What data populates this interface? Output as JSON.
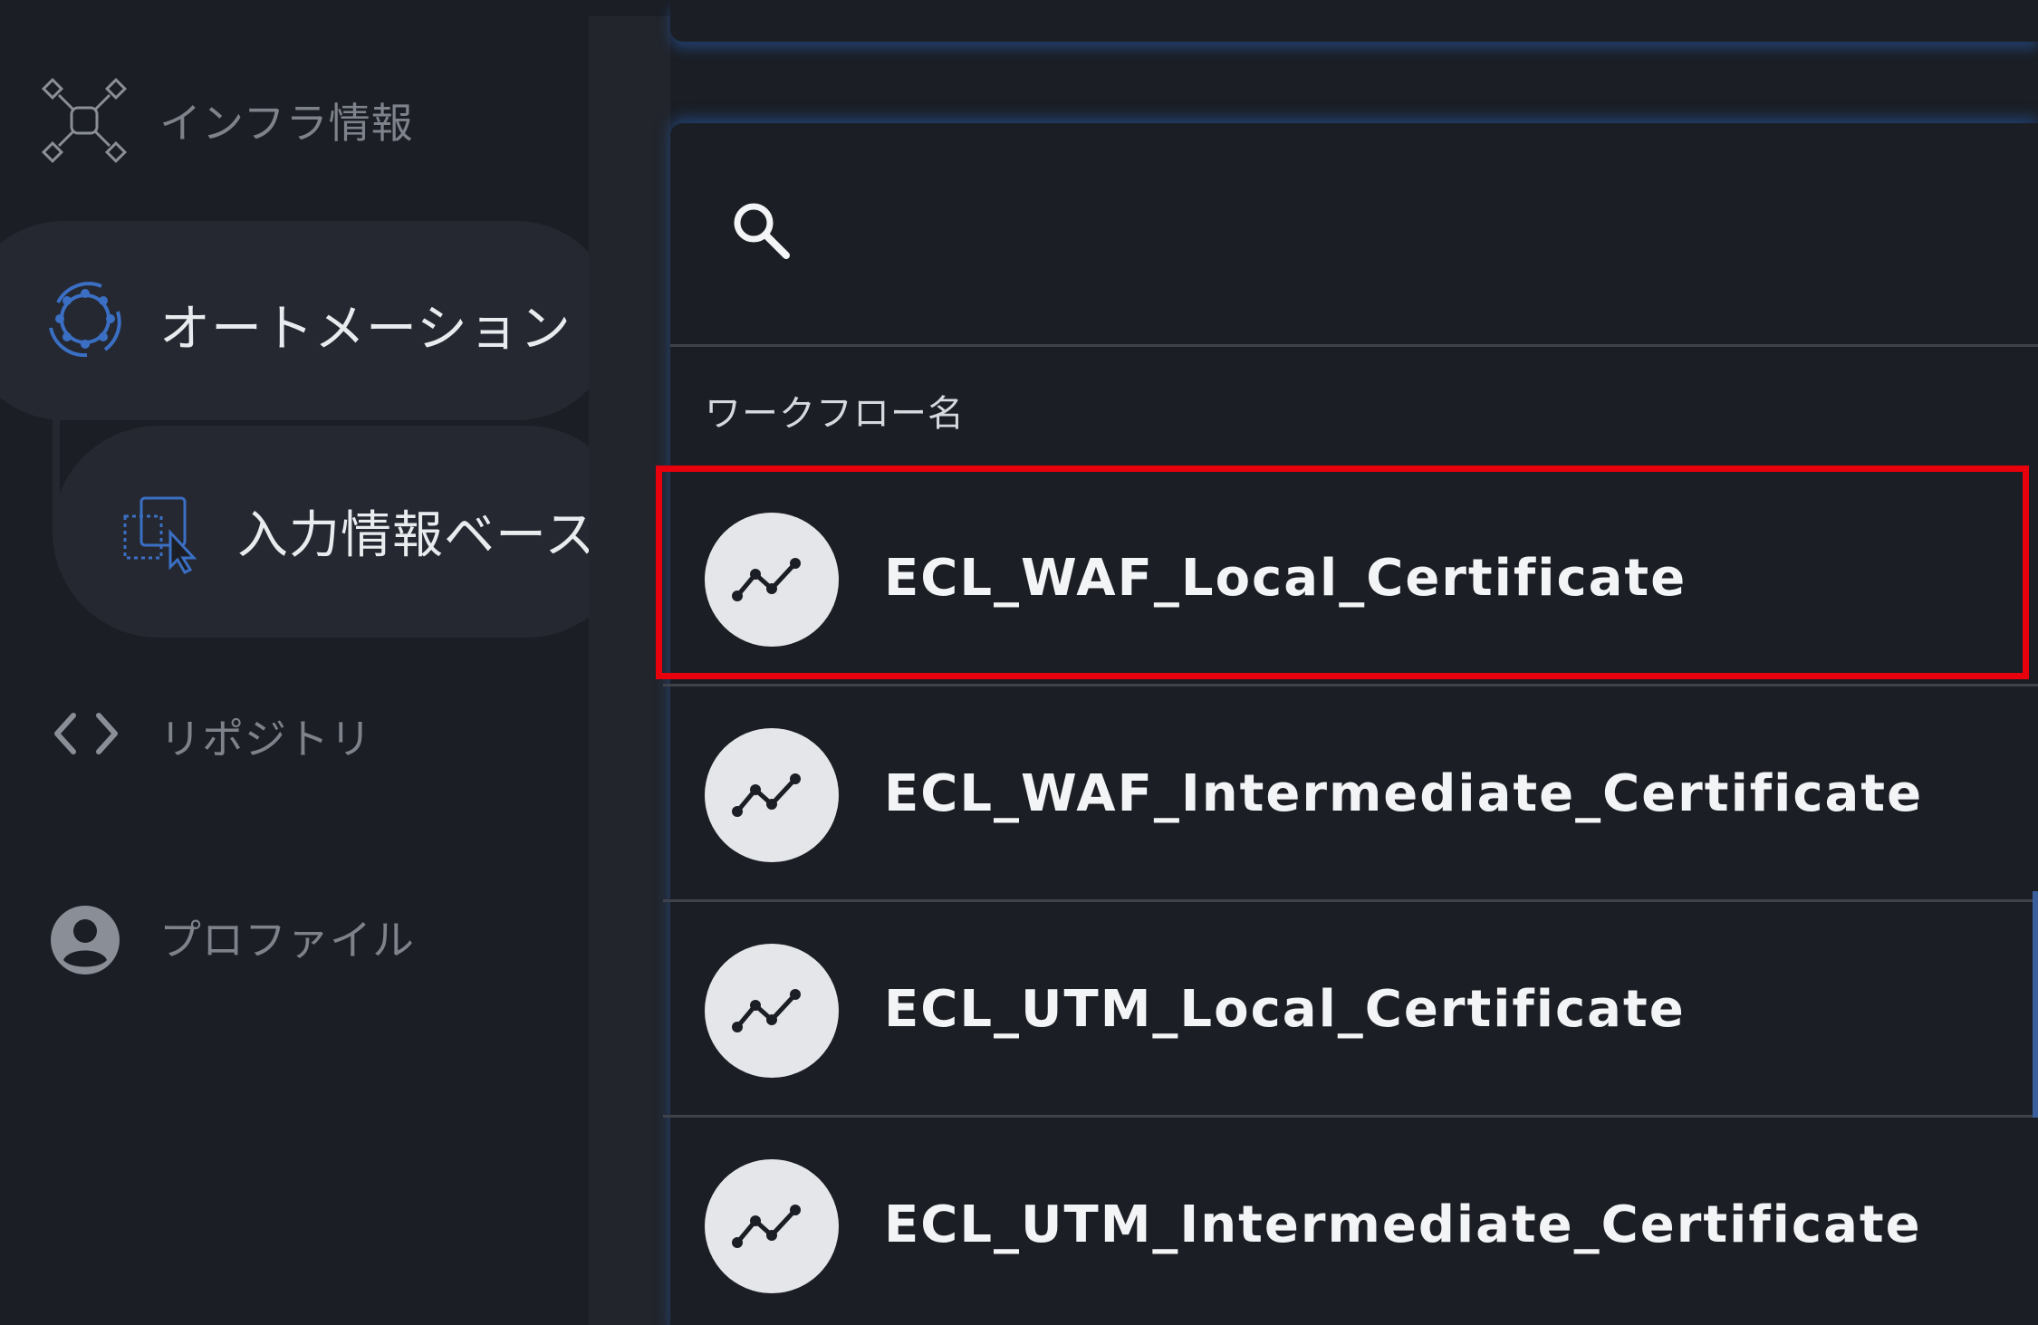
{
  "sidebar": {
    "items": [
      {
        "label": "インフラ情報",
        "icon": "network-nodes-icon",
        "active": false
      },
      {
        "label": "オートメーション",
        "icon": "automation-gear-icon",
        "active": true
      },
      {
        "label": "入力情報ベース",
        "icon": "input-cursor-icon",
        "active": true,
        "sub_item": true
      },
      {
        "label": "リポジトリ",
        "icon": "code-brackets-icon",
        "active": false
      },
      {
        "label": "プロファイル",
        "icon": "account-circle-icon",
        "active": false
      }
    ]
  },
  "search": {
    "placeholder": "",
    "value": ""
  },
  "table": {
    "column_header": "ワークフロー名",
    "rows": [
      {
        "name": "ECL_WAF_Local_Certificate",
        "highlighted": true
      },
      {
        "name": "ECL_WAF_Intermediate_Certificate",
        "highlighted": false
      },
      {
        "name": "ECL_UTM_Local_Certificate",
        "highlighted": false
      },
      {
        "name": "ECL_UTM_Intermediate_Certificate",
        "highlighted": false
      }
    ]
  },
  "colors": {
    "background": "#1b1e24",
    "active_pill": "#252830",
    "accent_blue": "#3a6fc4",
    "highlight_red": "#e8000c",
    "avatar_bg": "#e4e6e9"
  }
}
